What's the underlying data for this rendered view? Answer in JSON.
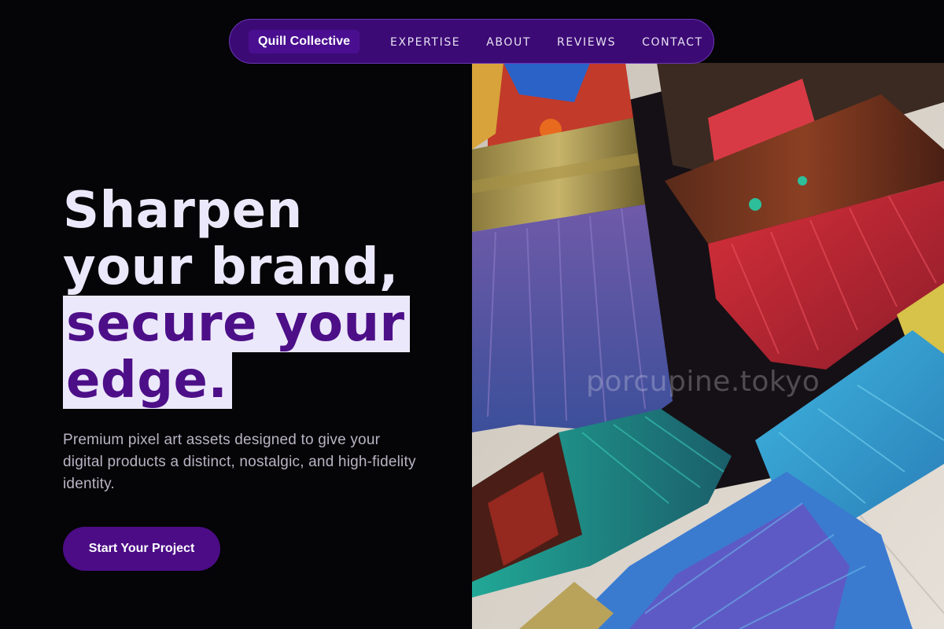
{
  "nav": {
    "brand": "Quill Collective",
    "links": [
      "EXPERTISE",
      "ABOUT",
      "REVIEWS",
      "CONTACT"
    ]
  },
  "hero": {
    "title_line1": "Sharpen",
    "title_line2": "your brand,",
    "title_highlight1": "secure your",
    "title_highlight2": "edge.",
    "subtitle": "Premium pixel art assets designed to give your digital products a distinct, nostalgic, and high-fidelity identity.",
    "cta_label": "Start Your Project"
  },
  "image": {
    "subject": "paint-brushes-photo",
    "watermark": "porcupine.tokyo"
  },
  "colors": {
    "background": "#050406",
    "nav_bg": "#3c0a75",
    "accent": "#4b0c86",
    "highlight_bg": "#ece8fb",
    "text_light": "#ece8fb",
    "text_muted": "#b9b4c4"
  }
}
